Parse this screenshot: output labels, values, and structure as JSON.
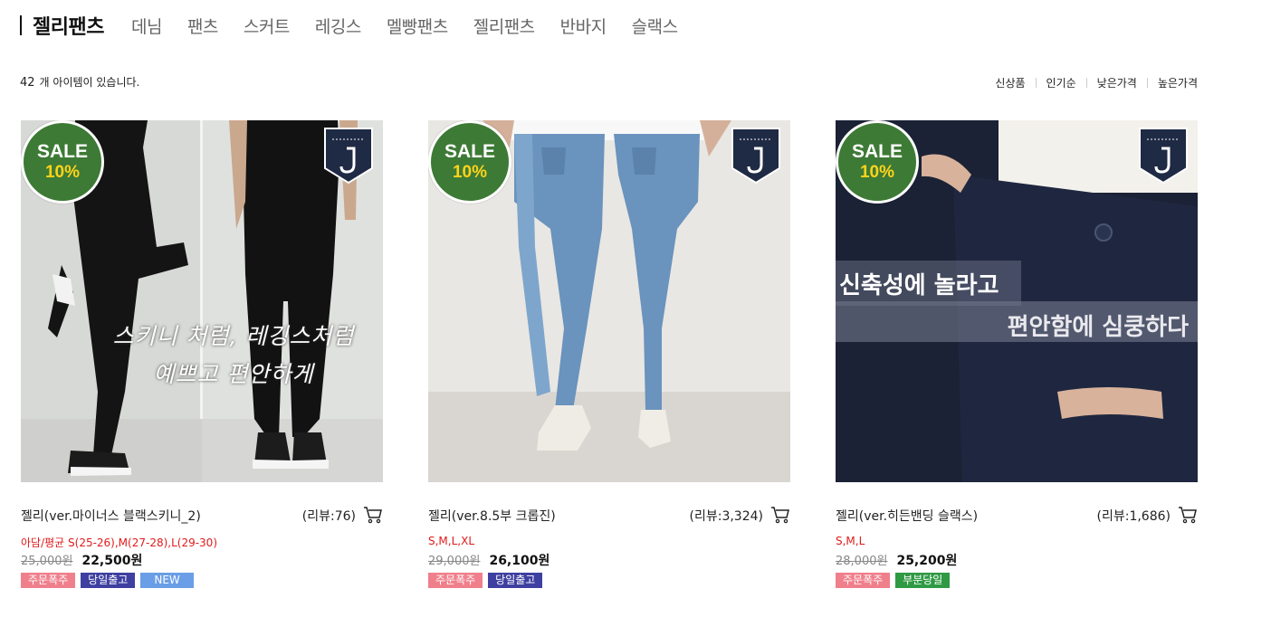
{
  "nav": {
    "title": "젤리팬츠",
    "items": [
      "데님",
      "팬츠",
      "스커트",
      "레깅스",
      "멜빵팬츠",
      "젤리팬츠",
      "반바지",
      "슬랙스"
    ]
  },
  "listing": {
    "count": "42",
    "count_suffix": "개 아이템이 있습니다."
  },
  "sort": [
    "신상품",
    "인기순",
    "낮은가격",
    "높은가격"
  ],
  "colors": {
    "sale_green": "#3d7a35",
    "sale_pct": "#ffd31a",
    "badge_pink": "#f07f8c",
    "badge_indigo": "#3e3fa0",
    "badge_blue": "#6a9ee6",
    "badge_green": "#2f9a44",
    "size_red": "#e01b1b"
  },
  "products": [
    {
      "sale_word": "SALE",
      "sale_pct": "10%",
      "overlay": [
        "스키니 처럼, 레깅스처럼",
        "예쁘고 편안하게"
      ],
      "name": "젤리(ver.마이너스 블랙스키니_2)",
      "review": "(리뷰:76)",
      "sizes": "아담/평균 S(25-26),M(27-28),L(29-30)",
      "old_price": "25,000원",
      "price": "22,500원",
      "badges": [
        {
          "label": "주문폭주",
          "color": "#f07f8c"
        },
        {
          "label": "당일출고",
          "color": "#3e3fa0"
        },
        {
          "label": "NEW",
          "color": "#6a9ee6"
        }
      ],
      "icons": [
        "sale-badge-icon",
        "jelly-pants-logo-icon",
        "cart-icon"
      ]
    },
    {
      "sale_word": "SALE",
      "sale_pct": "10%",
      "overlay": [],
      "name": "젤리(ver.8.5부 크롭진)",
      "review": "(리뷰:3,324)",
      "sizes": "S,M,L,XL",
      "old_price": "29,000원",
      "price": "26,100원",
      "badges": [
        {
          "label": "주문폭주",
          "color": "#f07f8c"
        },
        {
          "label": "당일출고",
          "color": "#3e3fa0"
        }
      ],
      "icons": [
        "sale-badge-icon",
        "jelly-pants-logo-icon",
        "cart-icon"
      ]
    },
    {
      "sale_word": "SALE",
      "sale_pct": "10%",
      "overlay": [
        "신축성에 놀라고",
        "편안함에 심쿵하다"
      ],
      "name": "젤리(ver.히든밴딩 슬랙스)",
      "review": "(리뷰:1,686)",
      "sizes": "S,M,L",
      "old_price": "28,000원",
      "price": "25,200원",
      "badges": [
        {
          "label": "주문폭주",
          "color": "#f07f8c"
        },
        {
          "label": "부분당일",
          "color": "#2f9a44"
        }
      ],
      "icons": [
        "sale-badge-icon",
        "jelly-pants-logo-icon",
        "cart-icon"
      ]
    }
  ]
}
